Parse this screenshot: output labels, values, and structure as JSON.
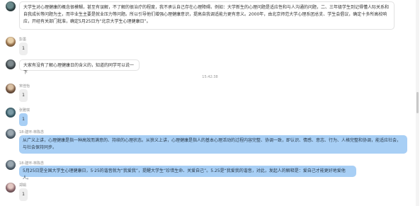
{
  "messages": [
    {
      "name": "",
      "text": "大学生对心理健康的概念很模糊，甚至有误解，不了解的很治疗的程度，我不承认自己存在心理障碍。例如：大学新生的心理问题是适应性和与人沟通的问题，二、三年级学生到记得懂人际关系和自我成长等问题为主，而毕业生主要是就业压力等问题。所以引导他们增强心理健康意识，提高自我调适能力更有意义。2000年，由北京师范大学心理系团总支、学生会倡议，确定十多所高校响应，开经有关部门批准，确定5月25日为“北京大学生心理健康日”。"
    },
    {
      "name": "彭墨",
      "text": "1"
    },
    {
      "name": "",
      "text": "大家有没有了解心理健康日的含义的，知道的同学可以说一下"
    },
    {
      "time": "15:42:38"
    },
    {
      "name": "宋佳怡",
      "text": "1"
    },
    {
      "name": "张雅琪",
      "text": "1"
    },
    {
      "name": "18-建环-林陈念",
      "text": "从广义上讲，心理健康是指一种高效而满意的、持续的心理状态。从狭义上讲，心理健康是指人的基本心理活动的过程内容完整、协调一致，即认识、情感、意志、行为、人格完整和协调，能适应社会，与社会保持同步。"
    },
    {
      "name": "18-建环-林陈念",
      "text": "5月25日是全国大学生心理健康日，5·25的谐音就为“我爱我”，提醒大学生“珍惜生命、关爱自己”。5.25是“我爱我的谐音，对此，发起人的解释是：爱自己才能更好地爱他人。"
    },
    {
      "name": "郑娟",
      "text": "1"
    }
  ]
}
